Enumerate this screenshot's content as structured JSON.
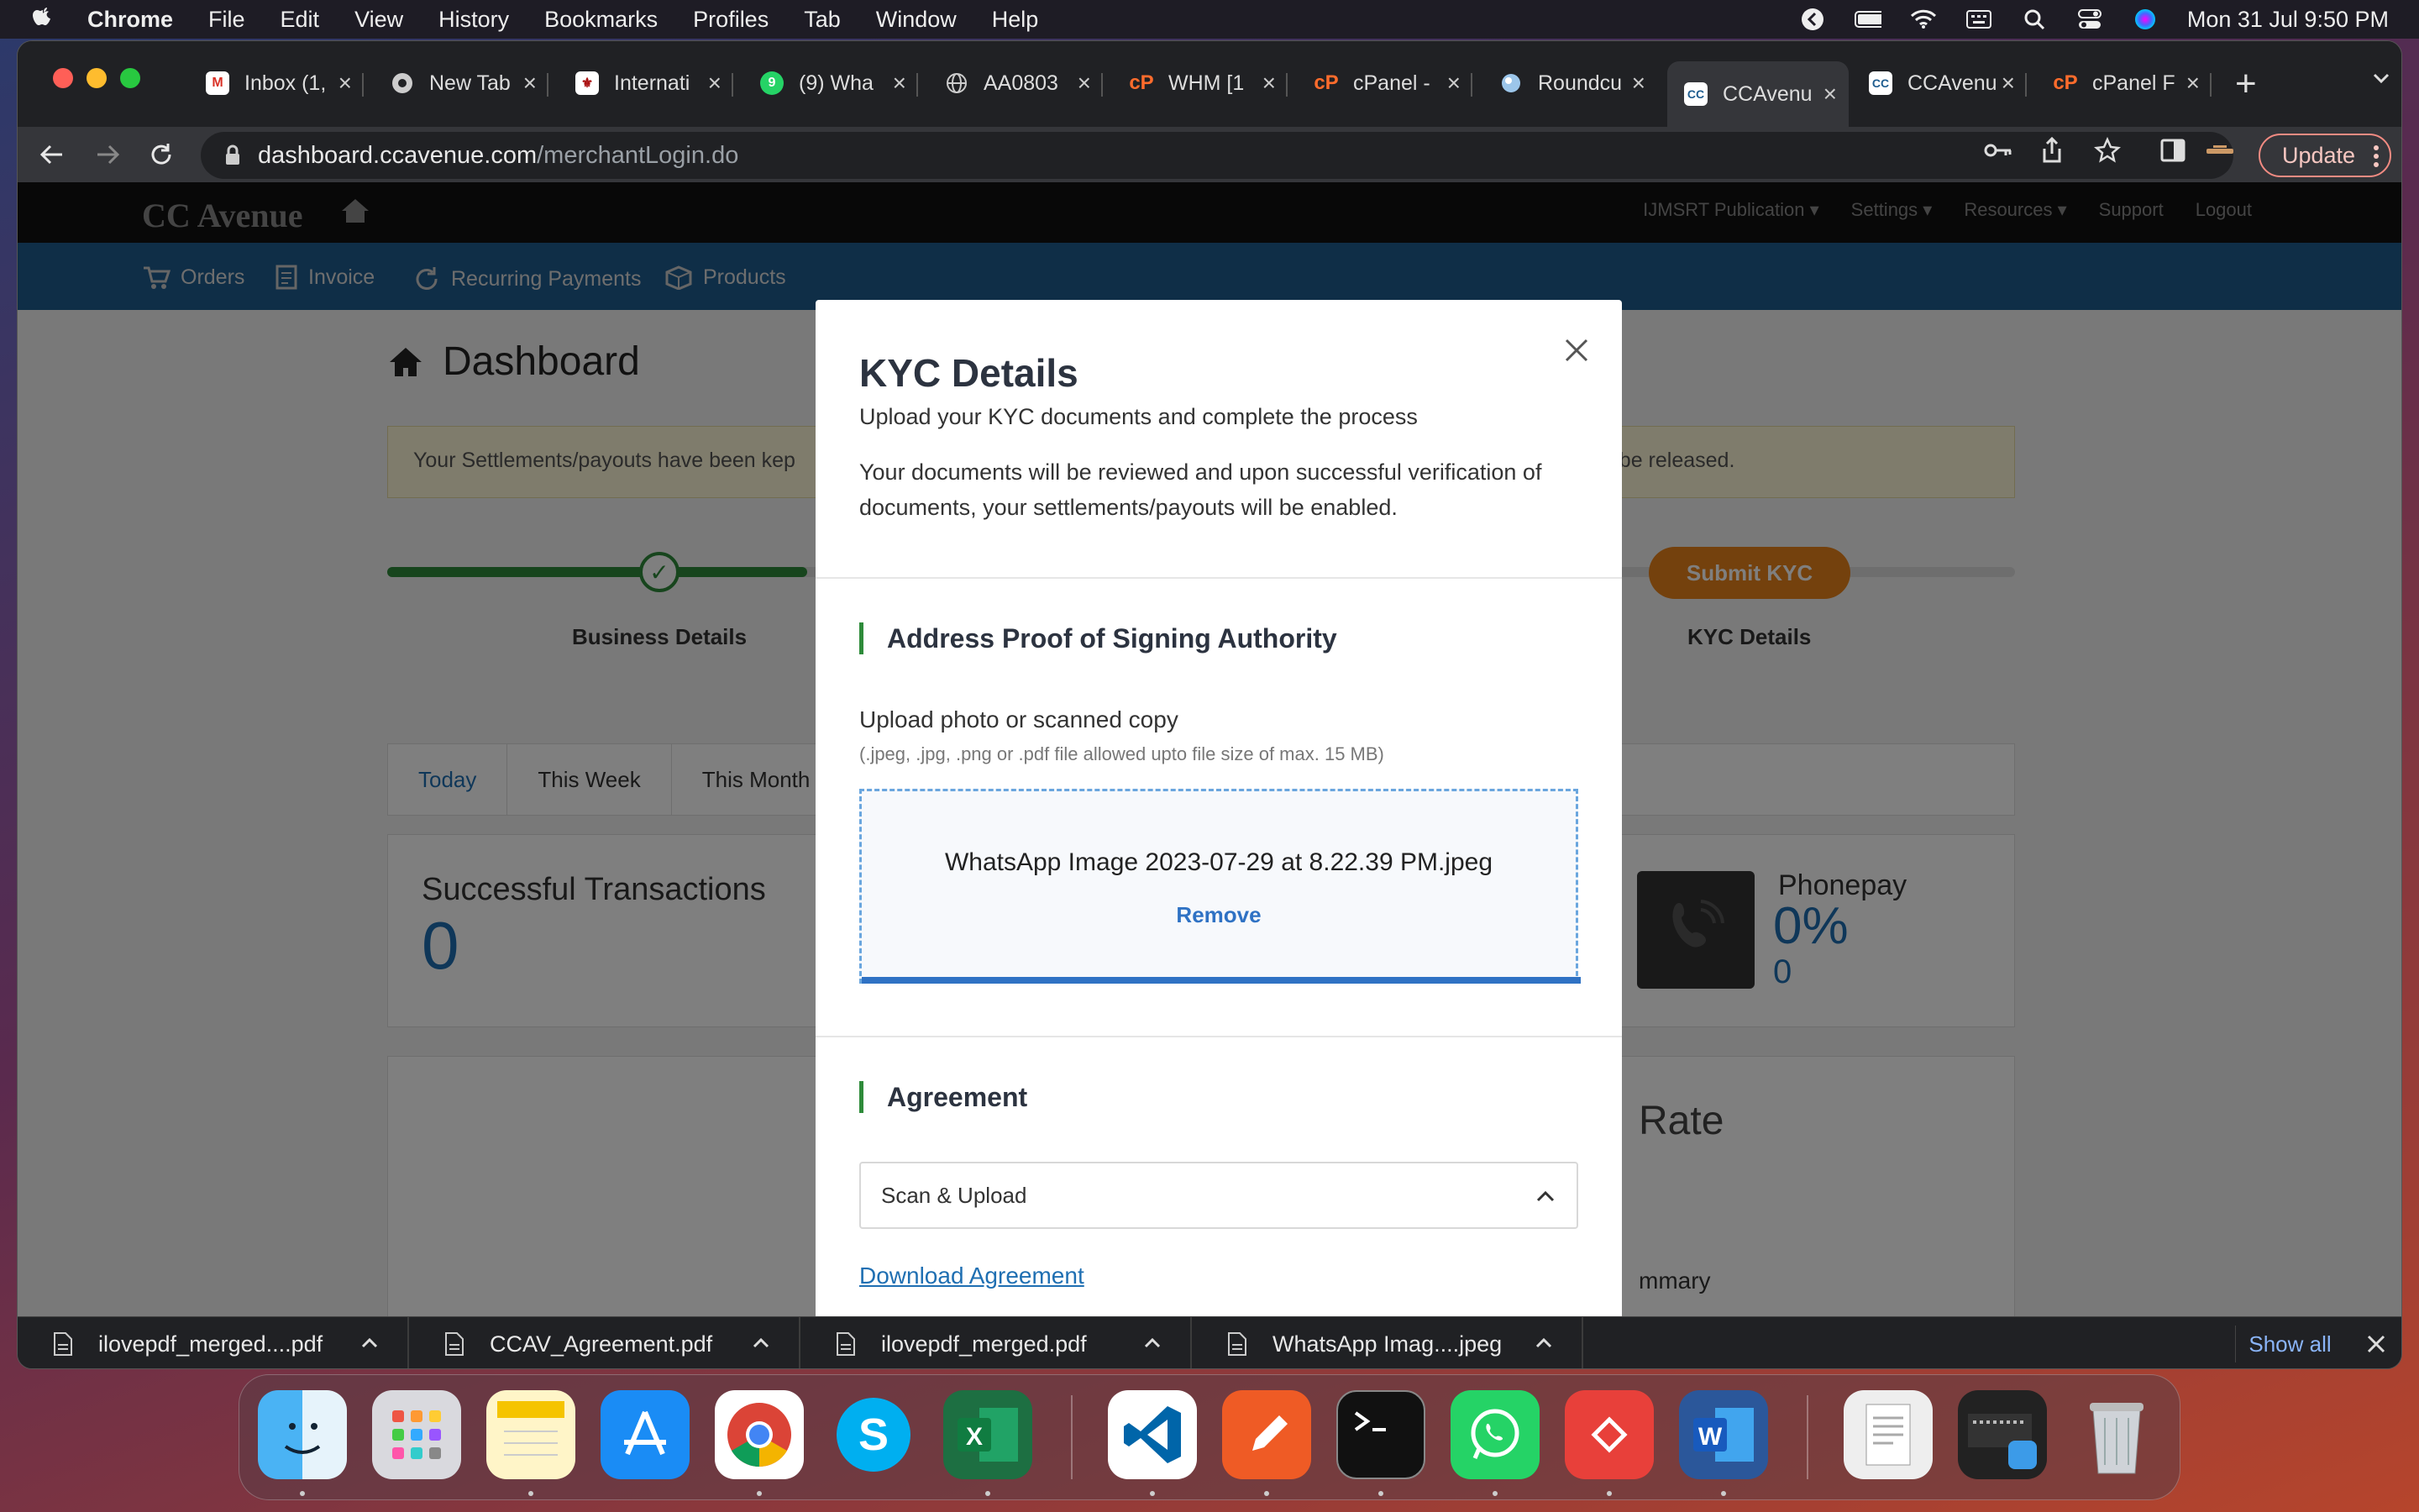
{
  "menubar": {
    "app": "Chrome",
    "items": [
      "File",
      "Edit",
      "View",
      "History",
      "Bookmarks",
      "Profiles",
      "Tab",
      "Window",
      "Help"
    ],
    "clock": "Mon 31 Jul  9:50 PM"
  },
  "browser": {
    "tabs": [
      {
        "label": "Inbox (1,",
        "icon": "gmail-icon"
      },
      {
        "label": "New Tab",
        "icon": "chrome-icon"
      },
      {
        "label": "Internati",
        "icon": "institution-icon"
      },
      {
        "label": "(9) Wha",
        "icon": "whatsapp-icon"
      },
      {
        "label": "AA0803",
        "icon": "globe-icon"
      },
      {
        "label": "WHM [1",
        "icon": "cpanel-icon"
      },
      {
        "label": "cPanel -",
        "icon": "cpanel-icon"
      },
      {
        "label": "Roundcu",
        "icon": "roundcube-icon"
      },
      {
        "label": "CCAvenu",
        "icon": "ccavenue-icon"
      },
      {
        "label": "CCAvenu",
        "icon": "ccavenue-icon"
      },
      {
        "label": "cPanel F",
        "icon": "cpanel-icon"
      }
    ],
    "active_tab_index": 8,
    "url_host": "dashboard.ccavenue.com",
    "url_path": "/merchantLogin.do",
    "update_label": "Update"
  },
  "site": {
    "logo": "CC Avenue",
    "topnav": [
      "IJMSRT Publication ▾",
      "Settings ▾",
      "Resources ▾",
      "Support",
      "Logout"
    ],
    "menu": [
      "Orders",
      "Invoice",
      "Recurring Payments",
      "Products"
    ],
    "dashboard_title": "Dashboard",
    "notice_left": "Your Settlements/payouts have been kep",
    "notice_right": "to be released.",
    "step_business": "Business Details",
    "step_kyc": "KYC Details",
    "submit_kyc": "Submit KYC",
    "period_tabs": [
      "Today",
      "This Week",
      "This Month"
    ],
    "successful_transactions_label": "Successful Transactions",
    "successful_transactions_value": "0",
    "phonepay_label": "Phonepay",
    "phonepay_percent": "0%",
    "phonepay_count": "0",
    "rate_fragment": "Rate",
    "summary_fragment": "mmary"
  },
  "modal": {
    "title": "KYC Details",
    "subtitle": "Upload your KYC documents and complete the process",
    "description": "Your documents will be reviewed and upon successful verification of documents, your settlements/payouts will be enabled.",
    "section1_title": "Address Proof of Signing Authority",
    "upload_label": "Upload photo or scanned copy",
    "upload_hint": "(.jpeg, .jpg, .png or .pdf file allowed upto file size of max. 15 MB)",
    "uploaded_filename": "WhatsApp Image 2023-07-29 at 8.22.39 PM.jpeg",
    "upload_progress_percent": 100,
    "remove_label": "Remove",
    "section2_title": "Agreement",
    "agreement_option": "Scan & Upload",
    "download_link": "Download Agreement"
  },
  "downloads": {
    "items": [
      "ilovepdf_merged....pdf",
      "CCAV_Agreement.pdf",
      "ilovepdf_merged.pdf",
      "WhatsApp Imag....jpeg"
    ],
    "show_all": "Show all"
  },
  "dock": {
    "apps": [
      "finder",
      "launchpad",
      "notes",
      "app-store",
      "chrome",
      "skype",
      "excel",
      "vscode",
      "postman",
      "terminal",
      "whatsapp",
      "anydesk",
      "word",
      "preview",
      "downloads-stack",
      "trash"
    ]
  }
}
